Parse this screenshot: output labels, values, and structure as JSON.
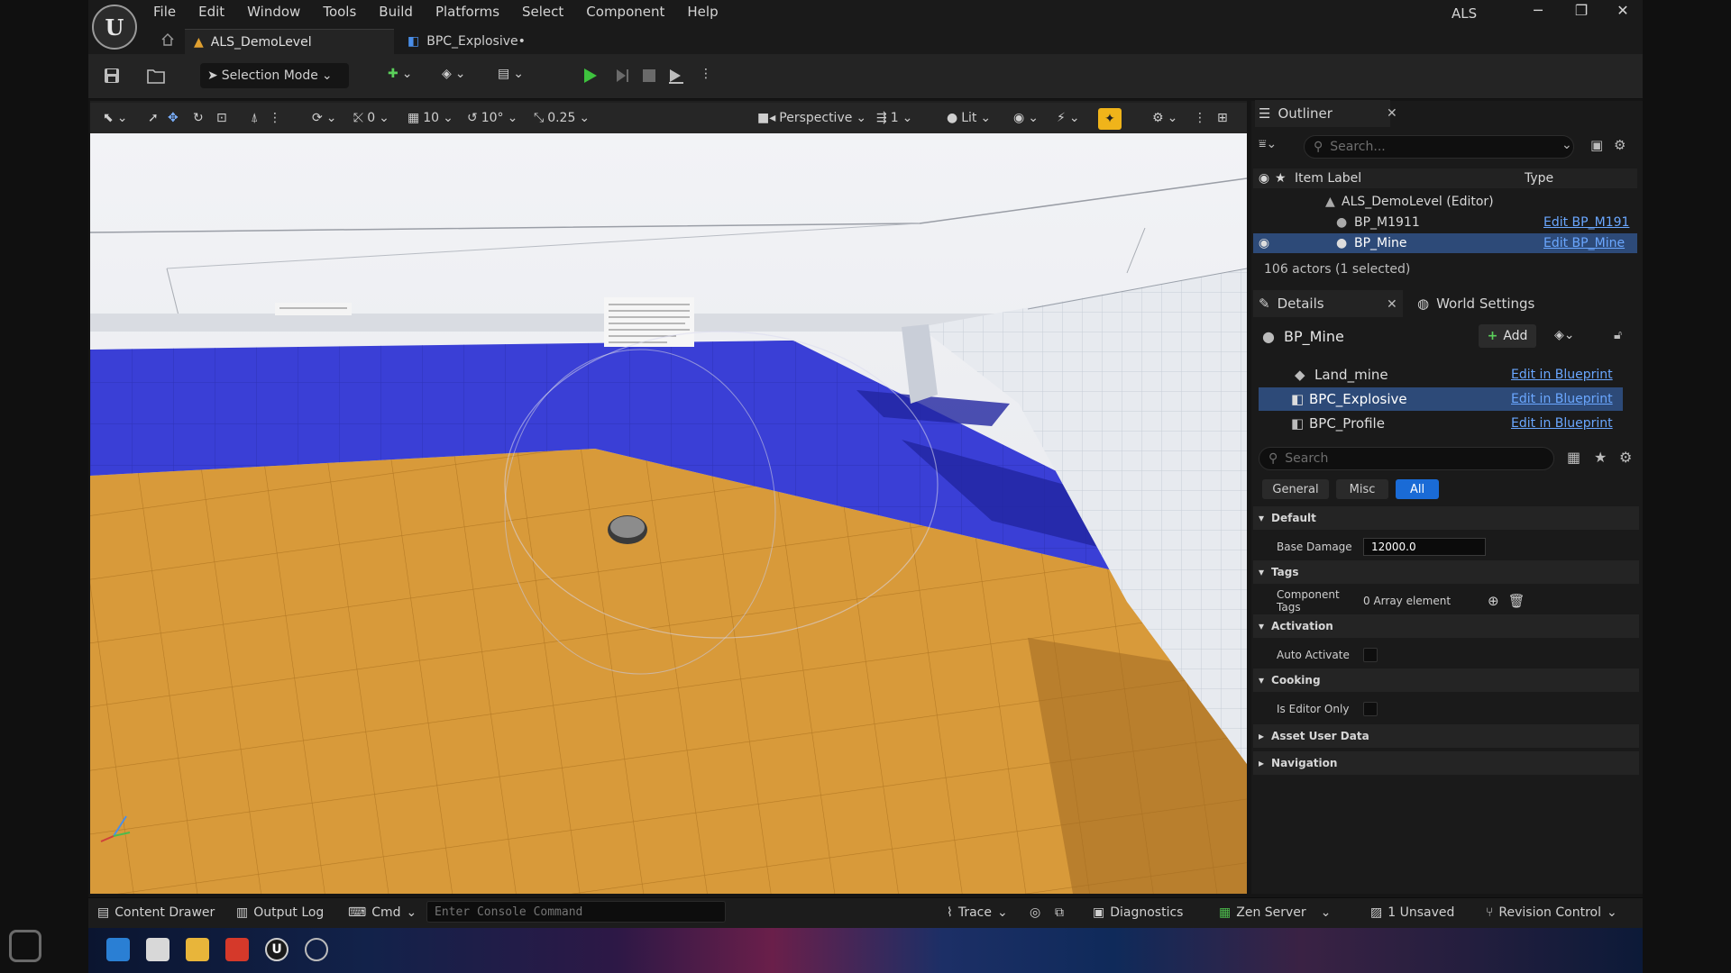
{
  "window": {
    "app_title": "ALS",
    "menu": [
      "File",
      "Edit",
      "Window",
      "Tools",
      "Build",
      "Platforms",
      "Select",
      "Component",
      "Help"
    ],
    "tabs": [
      {
        "label": "ALS_DemoLevel"
      },
      {
        "label": "BPC_Explosive•"
      }
    ]
  },
  "toolbar": {
    "selection_mode": "Selection Mode"
  },
  "viewport_toolbar": {
    "snap_rotation": "0",
    "grid_size": "10",
    "rotation_snap": "10°",
    "scale_snap": "0.25",
    "view_mode": "Perspective",
    "camera_count": "1",
    "lighting": "Lit"
  },
  "outliner": {
    "title": "Outliner",
    "search_placeholder": "Search...",
    "col_label": "Item Label",
    "col_type": "Type",
    "rows": [
      {
        "label": "ALS_DemoLevel (Editor)",
        "type": ""
      },
      {
        "label": "BP_M1911",
        "type": "Edit BP_M191"
      },
      {
        "label": "BP_Mine",
        "type": "Edit BP_Mine"
      }
    ],
    "status": "106 actors (1 selected)"
  },
  "details": {
    "tab_details": "Details",
    "tab_world": "World Settings",
    "actor_name": "BP_Mine",
    "add_label": "Add",
    "components": [
      {
        "name": "Land_mine",
        "link": "Edit in Blueprint"
      },
      {
        "name": "BPC_Explosive",
        "link": "Edit in Blueprint"
      },
      {
        "name": "BPC_Profile",
        "link": "Edit in Blueprint"
      }
    ],
    "search_placeholder": "Search",
    "filters": [
      "General",
      "Misc",
      "All"
    ],
    "sections": {
      "default": "Default",
      "tags": "Tags",
      "activation": "Activation",
      "cooking": "Cooking",
      "asset_user_data": "Asset User Data",
      "navigation": "Navigation"
    },
    "props": {
      "base_damage_label": "Base Damage",
      "base_damage_value": "12000.0",
      "component_tags_label": "Component Tags",
      "component_tags_value": "0 Array element",
      "auto_activate_label": "Auto Activate",
      "editor_only_label": "Is Editor Only"
    }
  },
  "statusbar": {
    "content_drawer": "Content Drawer",
    "output_log": "Output Log",
    "cmd": "Cmd",
    "console_placeholder": "Enter Console Command",
    "trace": "Trace",
    "diagnostics": "Diagnostics",
    "zen_server": "Zen Server",
    "unsaved": "1 Unsaved",
    "revision_control": "Revision Control"
  },
  "colors": {
    "accent_blue": "#1a6bd6",
    "link": "#6aa7ff",
    "play_green": "#3ec23e",
    "floor_blue": "#3a3fd6",
    "floor_orange": "#d89a3a"
  }
}
